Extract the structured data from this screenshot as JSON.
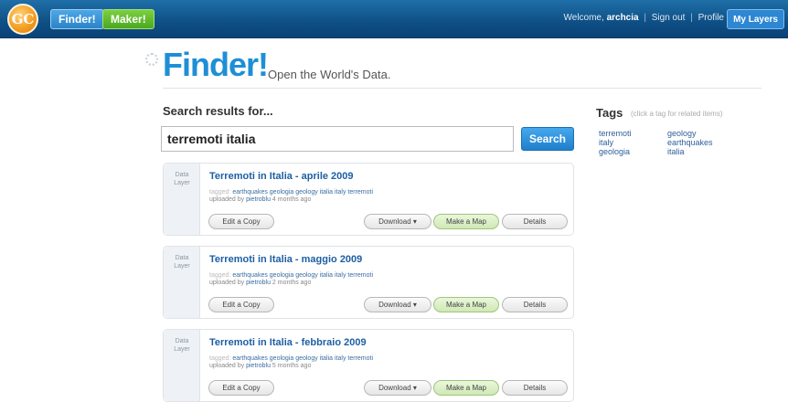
{
  "topbar": {
    "logo_text": "GC",
    "tabs": [
      "Finder!",
      "Maker!"
    ],
    "welcome_prefix": "Welcome,",
    "username": "archcia",
    "links": [
      "Sign out",
      "Profile"
    ],
    "my_layers": "My Layers"
  },
  "header": {
    "brand": "Finder!",
    "tagline": "Open the World's Data."
  },
  "search": {
    "heading": "Search results for...",
    "query": "terremoti italia",
    "button": "Search"
  },
  "results": [
    {
      "type_line1": "Data",
      "type_line2": "Layer",
      "title": "Terremoti in Italia - aprile 2009",
      "tagged_prefix": "tagged:",
      "tags": "earthquakes geologia geology italia italy terremoti",
      "uploaded_prefix": "uploaded by",
      "uploader": "pietroblu",
      "age": "4 months ago",
      "edit": "Edit a Copy",
      "download": "Download ▾",
      "map": "Make a Map",
      "details": "Details"
    },
    {
      "type_line1": "Data",
      "type_line2": "Layer",
      "title": "Terremoti in Italia - maggio 2009",
      "tagged_prefix": "tagged:",
      "tags": "earthquakes geologia geology italia italy terremoti",
      "uploaded_prefix": "uploaded by",
      "uploader": "pietroblu",
      "age": "2 months ago",
      "edit": "Edit a Copy",
      "download": "Download ▾",
      "map": "Make a Map",
      "details": "Details"
    },
    {
      "type_line1": "Data",
      "type_line2": "Layer",
      "title": "Terremoti in Italia - febbraio 2009",
      "tagged_prefix": "tagged:",
      "tags": "earthquakes geologia geology italia italy terremoti",
      "uploaded_prefix": "uploaded by",
      "uploader": "pietroblu",
      "age": "5 months ago",
      "edit": "Edit a Copy",
      "download": "Download ▾",
      "map": "Make a Map",
      "details": "Details"
    }
  ],
  "tags_panel": {
    "heading": "Tags",
    "hint": "(click a tag for related items)",
    "col1": [
      "terremoti",
      "italy",
      "geologia"
    ],
    "col2": [
      "geology",
      "earthquakes",
      "italia"
    ]
  }
}
